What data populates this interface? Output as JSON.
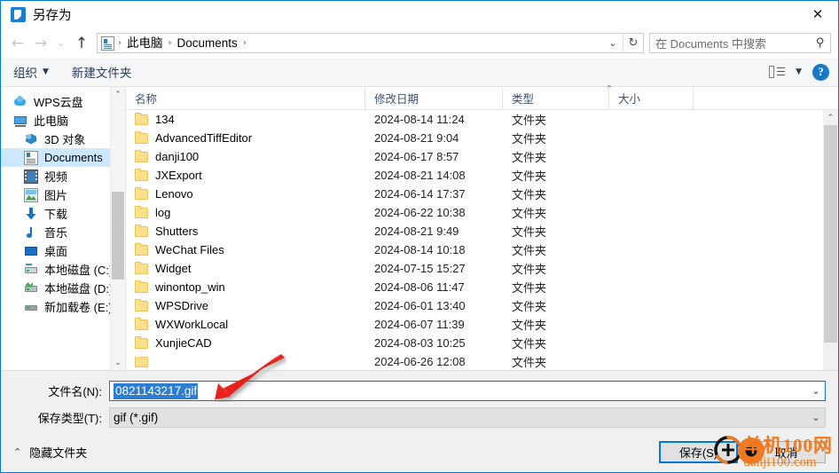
{
  "window": {
    "title": "另存为",
    "title_icon": "save-app-icon",
    "close_icon": "✕"
  },
  "nav": {
    "back_icon": "←",
    "forward_icon": "→",
    "recent_icon": "⌄",
    "up_icon": "↑",
    "address_icon": "documents-folder-icon",
    "breadcrumbs": [
      "此电脑",
      "Documents"
    ],
    "separator": "›",
    "dropdown_icon": "⌄",
    "refresh_icon": "↻"
  },
  "search": {
    "placeholder": "在 Documents 中搜索",
    "icon": "search-icon"
  },
  "toolbar": {
    "organize_label": "组织",
    "organize_caret": "▼",
    "new_folder_label": "新建文件夹",
    "view_caret": "▼",
    "help_label": "?"
  },
  "sidebar": {
    "items": [
      {
        "label": "WPS云盘",
        "icon": "cloud",
        "indent": false,
        "selected": false
      },
      {
        "label": "此电脑",
        "icon": "pc",
        "indent": false,
        "selected": false
      },
      {
        "label": "3D 对象",
        "icon": "cube",
        "indent": true,
        "selected": false
      },
      {
        "label": "Documents",
        "icon": "doc",
        "indent": true,
        "selected": true
      },
      {
        "label": "视频",
        "icon": "video",
        "indent": true,
        "selected": false
      },
      {
        "label": "图片",
        "icon": "pic",
        "indent": true,
        "selected": false
      },
      {
        "label": "下载",
        "icon": "down",
        "indent": true,
        "selected": false
      },
      {
        "label": "音乐",
        "icon": "music",
        "indent": true,
        "selected": false
      },
      {
        "label": "桌面",
        "icon": "desktop",
        "indent": true,
        "selected": false
      },
      {
        "label": "本地磁盘 (C:)",
        "icon": "drive-c",
        "indent": true,
        "selected": false
      },
      {
        "label": "本地磁盘 (D:)",
        "icon": "drive-d",
        "indent": true,
        "selected": false
      },
      {
        "label": "新加载卷 (E:)",
        "icon": "drive-e",
        "indent": true,
        "selected": false
      }
    ],
    "scroll_up_icon": "⌃",
    "scroll_down_icon": "⌄"
  },
  "filelist": {
    "columns": [
      "名称",
      "修改日期",
      "类型",
      "大小"
    ],
    "sort_indicator": "⌃",
    "scroll_up_icon": "⌃",
    "rows": [
      {
        "name": "134",
        "date": "2024-08-14 11:24",
        "type": "文件夹",
        "size": ""
      },
      {
        "name": "AdvancedTiffEditor",
        "date": "2024-08-21 9:04",
        "type": "文件夹",
        "size": ""
      },
      {
        "name": "danji100",
        "date": "2024-06-17 8:57",
        "type": "文件夹",
        "size": ""
      },
      {
        "name": "JXExport",
        "date": "2024-08-21 14:08",
        "type": "文件夹",
        "size": ""
      },
      {
        "name": "Lenovo",
        "date": "2024-06-14 17:37",
        "type": "文件夹",
        "size": ""
      },
      {
        "name": "log",
        "date": "2024-06-22 10:38",
        "type": "文件夹",
        "size": ""
      },
      {
        "name": "Shutters",
        "date": "2024-08-21 9:49",
        "type": "文件夹",
        "size": ""
      },
      {
        "name": "WeChat Files",
        "date": "2024-08-14 10:18",
        "type": "文件夹",
        "size": ""
      },
      {
        "name": "Widget",
        "date": "2024-07-15 15:27",
        "type": "文件夹",
        "size": ""
      },
      {
        "name": "winontop_win",
        "date": "2024-08-06 11:47",
        "type": "文件夹",
        "size": ""
      },
      {
        "name": "WPSDrive",
        "date": "2024-06-01 13:40",
        "type": "文件夹",
        "size": ""
      },
      {
        "name": "WXWorkLocal",
        "date": "2024-06-07 11:39",
        "type": "文件夹",
        "size": ""
      },
      {
        "name": "XunjieCAD",
        "date": "2024-08-03 10:25",
        "type": "文件夹",
        "size": ""
      },
      {
        "name": "",
        "date": "2024-06-26 12:08",
        "type": "文件夹",
        "size": ""
      }
    ]
  },
  "footer": {
    "filename_label": "文件名(N):",
    "filename_value": "0821143217.gif",
    "filetype_label": "保存类型(T):",
    "filetype_value": "gif (*.gif)",
    "combo_arrow": "⌄",
    "hide_folders_label": "隐藏文件夹",
    "hide_folders_icon": "⌃",
    "save_label": "保存(S)",
    "cancel_label": "取消"
  },
  "overlay": {
    "watermark_line1": "单机100网",
    "watermark_line2": "danji100.com",
    "watermark_color": "#f07a22",
    "arrow_color": "#e8201c"
  }
}
